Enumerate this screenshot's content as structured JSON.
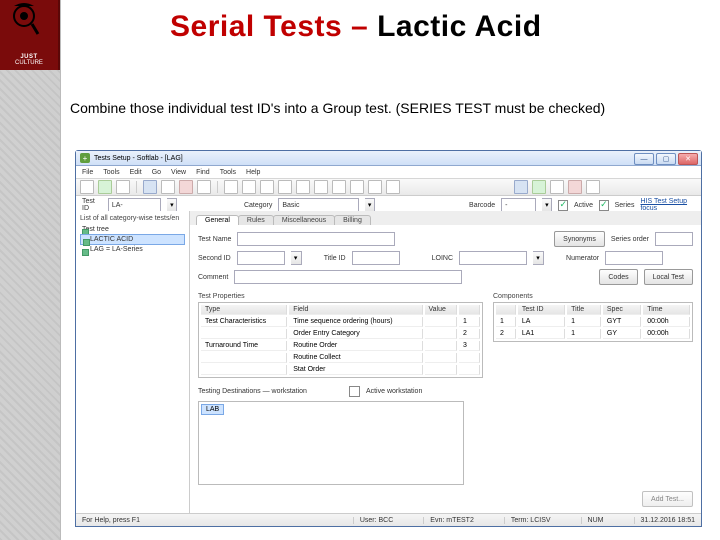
{
  "slide": {
    "title_red1": "Serial Tests ",
    "title_dash": "– ",
    "title_black": "Lactic Acid",
    "subtitle": "Combine those individual test ID's into a Group test. (SERIES TEST must be checked)",
    "logo": {
      "brand1": "JUST",
      "brand2": "CULTURE"
    }
  },
  "window": {
    "title": "Tests Setup - Softlab - [LAG]",
    "btn_min": "—",
    "btn_max": "▢",
    "btn_close": "✕"
  },
  "menu": [
    "File",
    "Tools",
    "Edit",
    "Go",
    "View",
    "Find",
    "Tools",
    "Help"
  ],
  "ribbon": {
    "testid_label": "Test ID",
    "testid_value": "LA-",
    "category_label": "Category",
    "category_value": "Basic",
    "barcode_label": "Barcode",
    "barcode_value": "-",
    "active_label": "Active",
    "series_label": "Series",
    "focus_link": "HIS Test Setup focus"
  },
  "tree": {
    "header": "List of all category-wise tests/en",
    "root": "Test tree",
    "children": [
      "LACTIC ACID",
      "LAG = LA-Series"
    ]
  },
  "tabs": [
    "General",
    "Rules",
    "Miscellaneous",
    "Billing"
  ],
  "form": {
    "testname_label": "Test Name",
    "testname_value": "",
    "synonyms_btn": "Synonyms",
    "series_order_lbl": "Series order",
    "series_order_val": "",
    "secondid_label": "Second ID",
    "titleid_label": "Title ID",
    "loinc_label": "LOINC",
    "numerator_label": "Numerator",
    "comment_label": "Comment",
    "codes_btn": "Codes",
    "localtest_btn": "Local Test"
  },
  "props": {
    "caption": "Test Properties",
    "cols": [
      "Type",
      "Field",
      "Value"
    ],
    "rows": [
      {
        "type": "Test Characteristics",
        "field": "Time sequence ordering (hours)",
        "value": ""
      },
      {
        "type": "",
        "field": "Order Entry Category",
        "value": ""
      },
      {
        "type": "Turnaround Time",
        "field": "Routine Order",
        "value": ""
      },
      {
        "type": "",
        "field": "Routine Collect",
        "value": ""
      },
      {
        "type": "",
        "field": "Stat Order",
        "value": ""
      }
    ],
    "numcol": [
      "1",
      "2",
      "3"
    ]
  },
  "comp": {
    "caption": "Components",
    "cols": [
      "",
      "Test ID",
      "Title",
      "Spec",
      "Time"
    ],
    "rows": [
      {
        "n": "1",
        "id": "LA",
        "title": "1",
        "spec": "GYT",
        "time": "00:00h"
      },
      {
        "n": "2",
        "id": "LA1",
        "title": "1",
        "spec": "GY",
        "time": "00:00h"
      }
    ]
  },
  "testing": {
    "caption": "Testing Destinations — workstation",
    "active_ws_label": "Active workstation",
    "addtest_btn": "Add Test...",
    "item": "LAB"
  },
  "status": {
    "help": "For Help, press F1",
    "user": "User: BCC",
    "env": "Evn: mTEST2",
    "term": "Term: LCISV",
    "num": "NUM",
    "time": "31.12.2016 18:51"
  }
}
